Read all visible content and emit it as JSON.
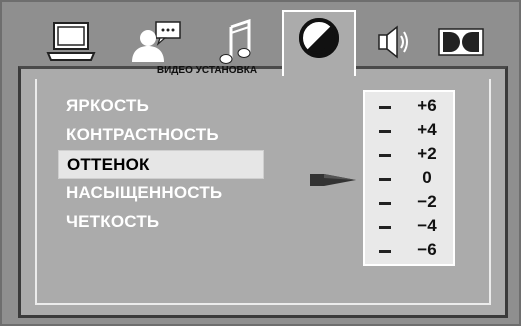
{
  "tabs": [
    {
      "icon": "monitor-icon"
    },
    {
      "icon": "user-chat-icon"
    },
    {
      "icon": "music-note-icon"
    },
    {
      "icon": "contrast-icon",
      "active": true
    },
    {
      "icon": "speaker-icon"
    },
    {
      "icon": "dolby-icon"
    }
  ],
  "section": {
    "title": "ВИДЕО УСТАНОВКА"
  },
  "menu": {
    "items": [
      {
        "label": "ЯРКОСТЬ"
      },
      {
        "label": "КОНТРАСТНОСТЬ"
      },
      {
        "label": "ОТТЕНОК"
      },
      {
        "label": "НАСЫЩЕННОСТЬ"
      },
      {
        "label": "ЧЕТКОСТЬ"
      }
    ],
    "selected_index": 2
  },
  "scale": {
    "values": [
      "+6",
      "+4",
      "+2",
      "0",
      "−2",
      "−4",
      "−6"
    ],
    "current": "0"
  },
  "colors": {
    "background": "#8f8f8f",
    "panel": "#ababab",
    "highlight": "#e6e6e6",
    "text": "#ffffff"
  }
}
